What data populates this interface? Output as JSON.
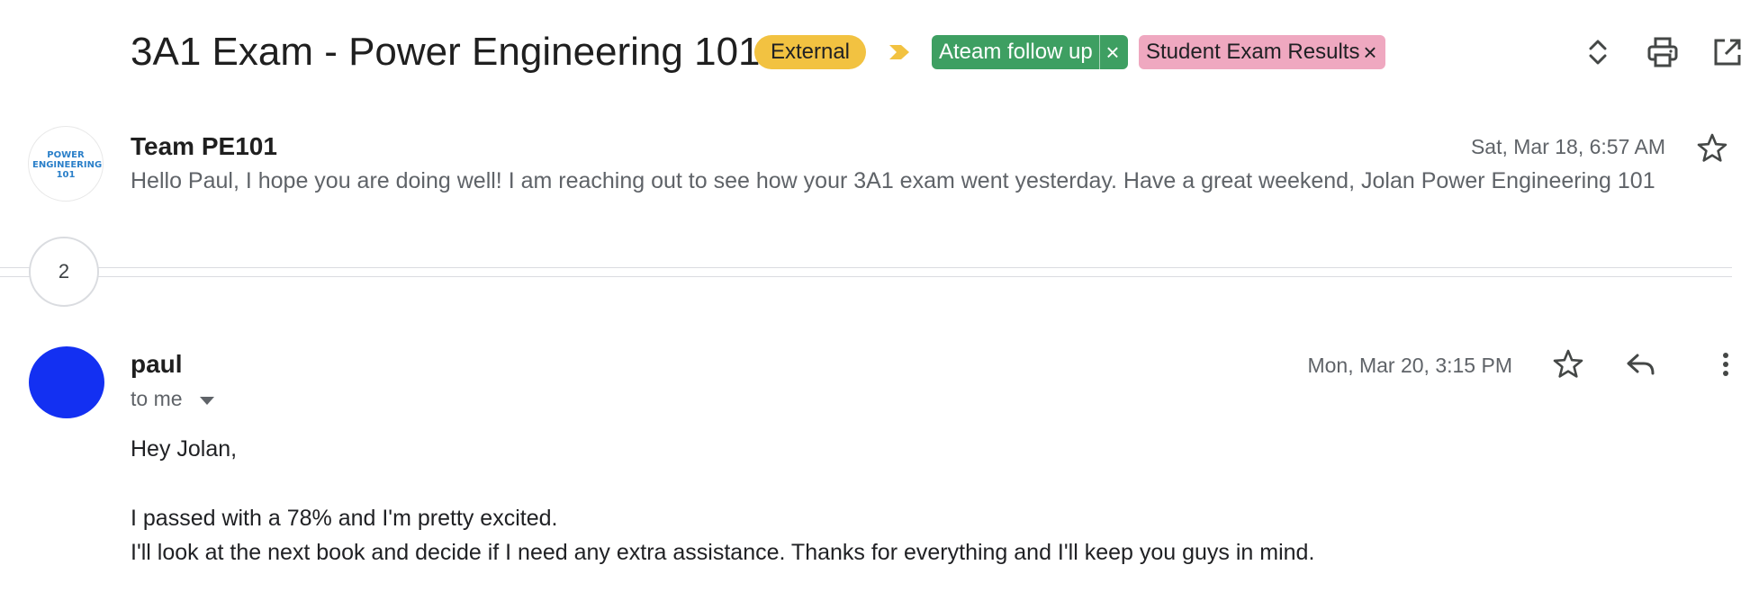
{
  "thread": {
    "subject": "3A1 Exam - Power Engineering 101",
    "labels": {
      "external": "External",
      "ateam": "Ateam follow up",
      "exam": "Student Exam Results",
      "remove_symbol": "×"
    },
    "colors": {
      "external": "#f2c241",
      "ateam": "#3e9f62",
      "exam": "#efa8c0",
      "avatar_paul": "#1330f2"
    }
  },
  "message1": {
    "sender": "Team PE101",
    "date": "Sat, Mar 18, 6:57 AM",
    "snippet": "Hello Paul, I hope you are doing well! I am reaching out to see how your 3A1 exam went yesterday. Have a great weekend, Jolan Power Engineering 101",
    "avatar_logo_line1": "POWER",
    "avatar_logo_line2": "ENGINEERING",
    "avatar_logo_line3": "101"
  },
  "collapsed": {
    "count": "2"
  },
  "message2": {
    "sender": "paul",
    "date": "Mon, Mar 20, 3:15 PM",
    "recipient": "to me",
    "body": [
      "Hey Jolan,",
      "I passed with a 78% and I'm pretty excited.",
      "I'll look at the next book and decide if I need any extra assistance. Thanks for everything and I'll keep you guys in mind."
    ]
  },
  "icons": [
    "expand-collapse-icon",
    "print-icon",
    "open-in-new-window-icon",
    "star-icon",
    "reply-icon",
    "more-vert-icon",
    "label-arrow-icon",
    "dropdown-caret-icon"
  ]
}
